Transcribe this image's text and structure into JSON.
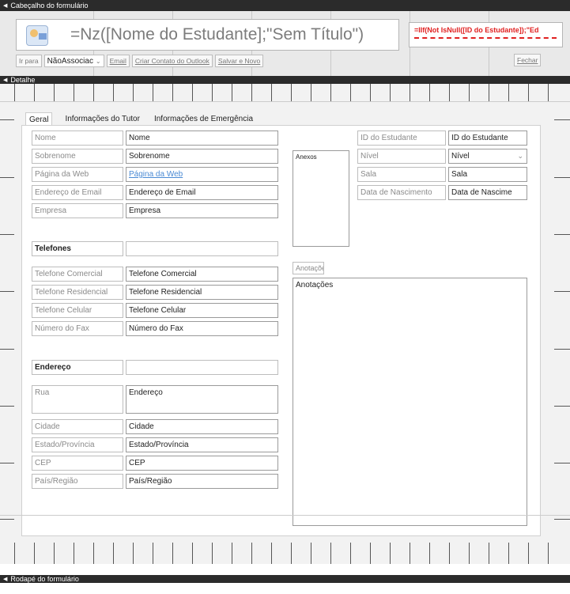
{
  "sections": {
    "header": "Cabeçalho do formulário",
    "detail": "Detalhe",
    "footer": "Rodapé do formulário"
  },
  "header": {
    "title_expression": "=Nz([Nome do Estudante];\"Sem Título\")",
    "red_expression": "=IIf(Not IsNull([ID do Estudante]);\"Ed",
    "toolbar": {
      "ir_para": "Ir para",
      "combo_value": "NãoAssociac",
      "email": "Email",
      "criar_contato": "Criar Contato do Outlook",
      "salvar_novo": "Salvar e Novo",
      "fechar": "Fechar"
    }
  },
  "tabs": [
    "Geral",
    "Informações do Tutor",
    "Informações de Emergência"
  ],
  "personal": [
    {
      "label": "Nome",
      "value": "Nome"
    },
    {
      "label": "Sobrenome",
      "value": "Sobrenome"
    },
    {
      "label": "Página da Web",
      "value": "Página da Web"
    },
    {
      "label": "Endereço de Email",
      "value": "Endereço de Email"
    },
    {
      "label": "Empresa",
      "value": "Empresa"
    }
  ],
  "phones": {
    "heading": "Telefones",
    "rows": [
      {
        "label": "Telefone Comercial",
        "value": "Telefone Comercial"
      },
      {
        "label": "Telefone Residencial",
        "value": "Telefone Residencial"
      },
      {
        "label": "Telefone Celular",
        "value": "Telefone Celular"
      },
      {
        "label": "Número do Fax",
        "value": "Número do Fax"
      }
    ]
  },
  "address": {
    "heading": "Endereço",
    "street": {
      "label": "Rua",
      "value": "Endereço"
    },
    "rows": [
      {
        "label": "Cidade",
        "value": "Cidade"
      },
      {
        "label": "Estado/Província",
        "value": "Estado/Província"
      },
      {
        "label": "CEP",
        "value": "CEP"
      },
      {
        "label": "País/Região",
        "value": "País/Região"
      }
    ]
  },
  "attachments": {
    "label": "Anexos"
  },
  "student": [
    {
      "label": "ID do Estudante",
      "value": "ID do Estudante"
    },
    {
      "label": "Nível",
      "value": "Nível"
    },
    {
      "label": "Sala",
      "value": "Sala"
    },
    {
      "label": "Data de Nascimento",
      "value": "Data de Nascime"
    }
  ],
  "notes": {
    "label": "Anotações",
    "value": "Anotações"
  }
}
